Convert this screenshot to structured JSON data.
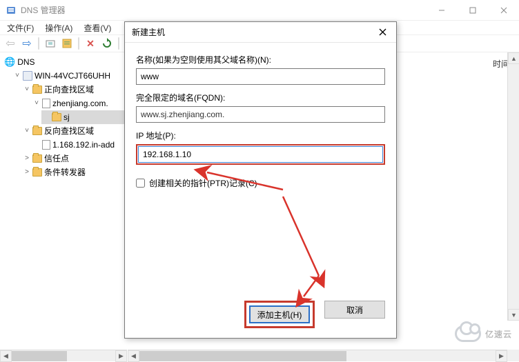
{
  "window": {
    "title": "DNS 管理器",
    "min": "—",
    "max": "☐",
    "close": "✕"
  },
  "menu": {
    "file": "文件(F)",
    "action": "操作(A)",
    "view": "查看(V)"
  },
  "tree": {
    "root": "DNS",
    "server": "WIN-44VCJT66UHH",
    "fwd_zone": "正向查找区域",
    "zone1": "zhenjiang.com.",
    "sub1": "sj",
    "rev_zone": "反向查找区域",
    "rev1": "1.168.192.in-add",
    "trust": "信任点",
    "cond": "条件转发器"
  },
  "right_header": "时间戳",
  "dialog": {
    "title": "新建主机",
    "name_label": "名称(如果为空则使用其父域名称)(N):",
    "name_value": "www",
    "fqdn_label": "完全限定的域名(FQDN):",
    "fqdn_value": "www.sj.zhenjiang.com.",
    "ip_label": "IP 地址(P):",
    "ip_value": "192.168.1.10",
    "ptr_label": "创建相关的指针(PTR)记录(C)",
    "add_btn": "添加主机(H)",
    "cancel_btn": "取消"
  },
  "watermark": "亿速云"
}
